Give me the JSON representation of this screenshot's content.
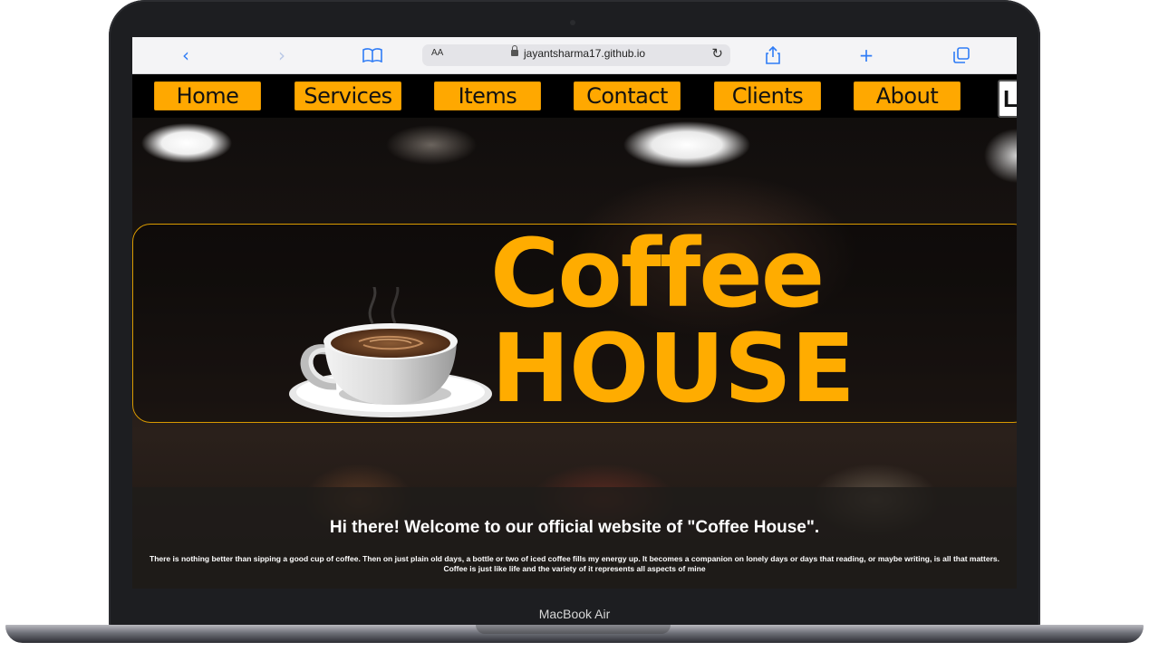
{
  "device": {
    "label": "MacBook Air"
  },
  "browser": {
    "text_size_label": "AA",
    "url": "jayantsharma17.github.io",
    "icons": [
      "back-icon",
      "forward-icon",
      "bookmarks-icon",
      "lock-icon",
      "reload-icon",
      "share-icon",
      "new-tab-icon",
      "tabs-icon"
    ]
  },
  "nav": {
    "items": [
      "Home",
      "Services",
      "Items",
      "Contact",
      "Clients",
      "About"
    ],
    "partial_item": "L"
  },
  "hero": {
    "title_line1": "Coffee",
    "title_line2": "HOUSE",
    "icon": "coffee-cup-icon"
  },
  "intro": {
    "heading": "Hi there! Welcome to our official website of \"Coffee House\".",
    "body": "There is nothing better than sipping a good cup of coffee. Then on just plain old days, a bottle or two of iced coffee fills my energy up. It becomes a companion on lonely days or days that reading, or maybe writing, is all that matters. Coffee is just like life and the variety of it represents all aspects of mine"
  },
  "colors": {
    "accent": "#ffa800",
    "title": "#ffac00",
    "browser_blue": "#2f7cf6"
  }
}
